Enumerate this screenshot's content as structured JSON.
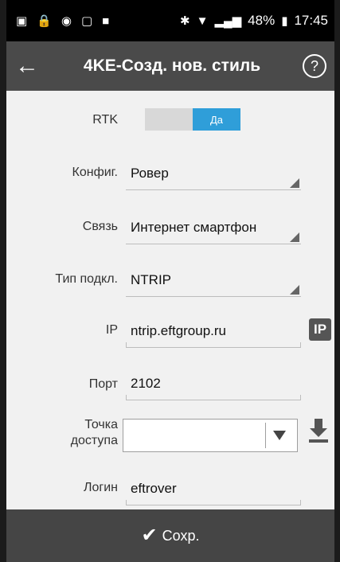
{
  "status": {
    "battery": "48%",
    "time": "17:45"
  },
  "appbar": {
    "title": "4KE-Созд. нов. стиль"
  },
  "form": {
    "rtk": {
      "label": "RTK",
      "value": "Да"
    },
    "config": {
      "label": "Конфиг.",
      "value": "Ровер"
    },
    "link": {
      "label": "Связь",
      "value": "Интернет смартфон"
    },
    "conn_type": {
      "label": "Тип подкл.",
      "value": "NTRIP"
    },
    "ip": {
      "label": "IP",
      "value": "ntrip.eftgroup.ru",
      "button": "IP"
    },
    "port": {
      "label": "Порт",
      "value": "2102"
    },
    "mount": {
      "label_line1": "Точка",
      "label_line2": "доступа",
      "value": ""
    },
    "login": {
      "label": "Логин",
      "value": "eftrover"
    }
  },
  "footer": {
    "save_label": "Сохр."
  }
}
